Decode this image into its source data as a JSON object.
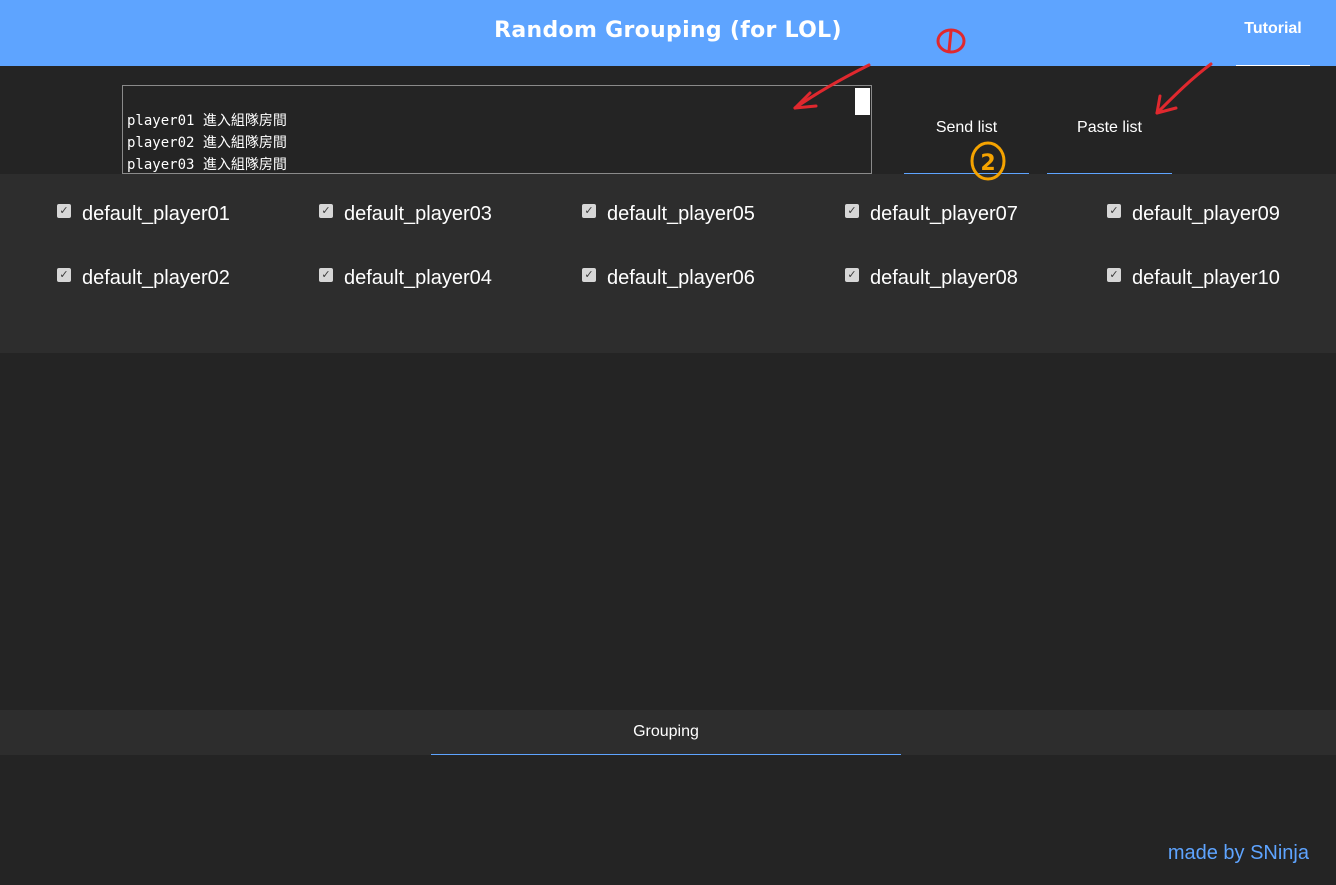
{
  "header": {
    "title": "Random Grouping (for LOL)",
    "tutorial_label": "Tutorial"
  },
  "input": {
    "value": "player01 進入組隊房間\nplayer02 進入組隊房間\nplayer03 進入組隊房間"
  },
  "actions": {
    "send_label": "Send list",
    "paste_label": "Paste list"
  },
  "players": [
    {
      "name": "default_player01",
      "checked": true
    },
    {
      "name": "default_player02",
      "checked": true
    },
    {
      "name": "default_player03",
      "checked": true
    },
    {
      "name": "default_player04",
      "checked": true
    },
    {
      "name": "default_player05",
      "checked": true
    },
    {
      "name": "default_player06",
      "checked": true
    },
    {
      "name": "default_player07",
      "checked": true
    },
    {
      "name": "default_player08",
      "checked": true
    },
    {
      "name": "default_player09",
      "checked": true
    },
    {
      "name": "default_player10",
      "checked": true
    }
  ],
  "grouping": {
    "label": "Grouping"
  },
  "footer": {
    "credit": "made by SNinja"
  },
  "annotations": {
    "step1_label": "①",
    "step2_label": "2"
  },
  "colors": {
    "header_bg": "#5ea4ff",
    "accent": "#5ea4ff",
    "page_bg": "#242424",
    "panel_bg": "#2d2d2d",
    "annotation_red": "#e0282e",
    "annotation_orange": "#f5a300"
  }
}
